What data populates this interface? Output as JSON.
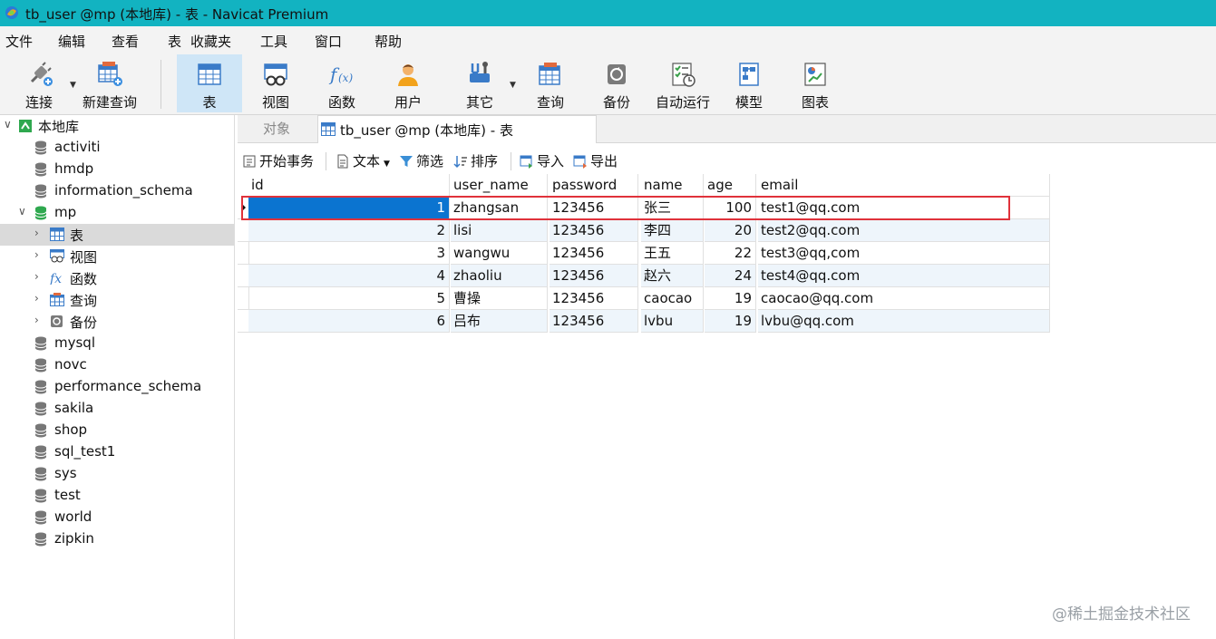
{
  "window": {
    "title": "tb_user @mp (本地库) - 表 - Navicat Premium"
  },
  "menu": [
    "文件",
    "编辑",
    "查看",
    "表",
    "收藏夹",
    "工具",
    "窗口",
    "帮助"
  ],
  "toolbar": {
    "connect": "连接",
    "new_query": "新建查询",
    "table": "表",
    "view": "视图",
    "function": "函数",
    "user": "用户",
    "other": "其它",
    "query": "查询",
    "backup": "备份",
    "automation": "自动运行",
    "model": "模型",
    "chart": "图表"
  },
  "sidebar": {
    "connection": "本地库",
    "databases": [
      "activiti",
      "hmdp",
      "information_schema",
      "mp",
      "mysql",
      "novc",
      "performance_schema",
      "sakila",
      "shop",
      "sql_test1",
      "sys",
      "test",
      "world",
      "zipkin"
    ],
    "mp_children": [
      "表",
      "视图",
      "函数",
      "查询",
      "备份"
    ]
  },
  "tabs": {
    "objects": "对象",
    "active": "tb_user @mp (本地库) - 表"
  },
  "subtoolbar": {
    "begin_transaction": "开始事务",
    "text": "文本",
    "filter": "筛选",
    "sort": "排序",
    "import": "导入",
    "export": "导出"
  },
  "table": {
    "columns": [
      "id",
      "user_name",
      "password",
      "name",
      "age",
      "email"
    ],
    "rows": [
      [
        "1",
        "zhangsan",
        "123456",
        "张三",
        "100",
        "test1@qq.com"
      ],
      [
        "2",
        "lisi",
        "123456",
        "李四",
        "20",
        "test2@qq.com"
      ],
      [
        "3",
        "wangwu",
        "123456",
        "王五",
        "22",
        "test3@qq,com"
      ],
      [
        "4",
        "zhaoliu",
        "123456",
        "赵六",
        "24",
        "test4@qq.com"
      ],
      [
        "5",
        "曹操",
        "123456",
        "caocao",
        "19",
        "caocao@qq.com"
      ],
      [
        "6",
        "吕布",
        "123456",
        "lvbu",
        "19",
        "lvbu@qq.com"
      ]
    ]
  },
  "watermark": "@稀土掘金技术社区",
  "colors": {
    "titlebar": "#12b3c1",
    "selection": "#0b74d0",
    "highlight_box": "#e0323b"
  }
}
